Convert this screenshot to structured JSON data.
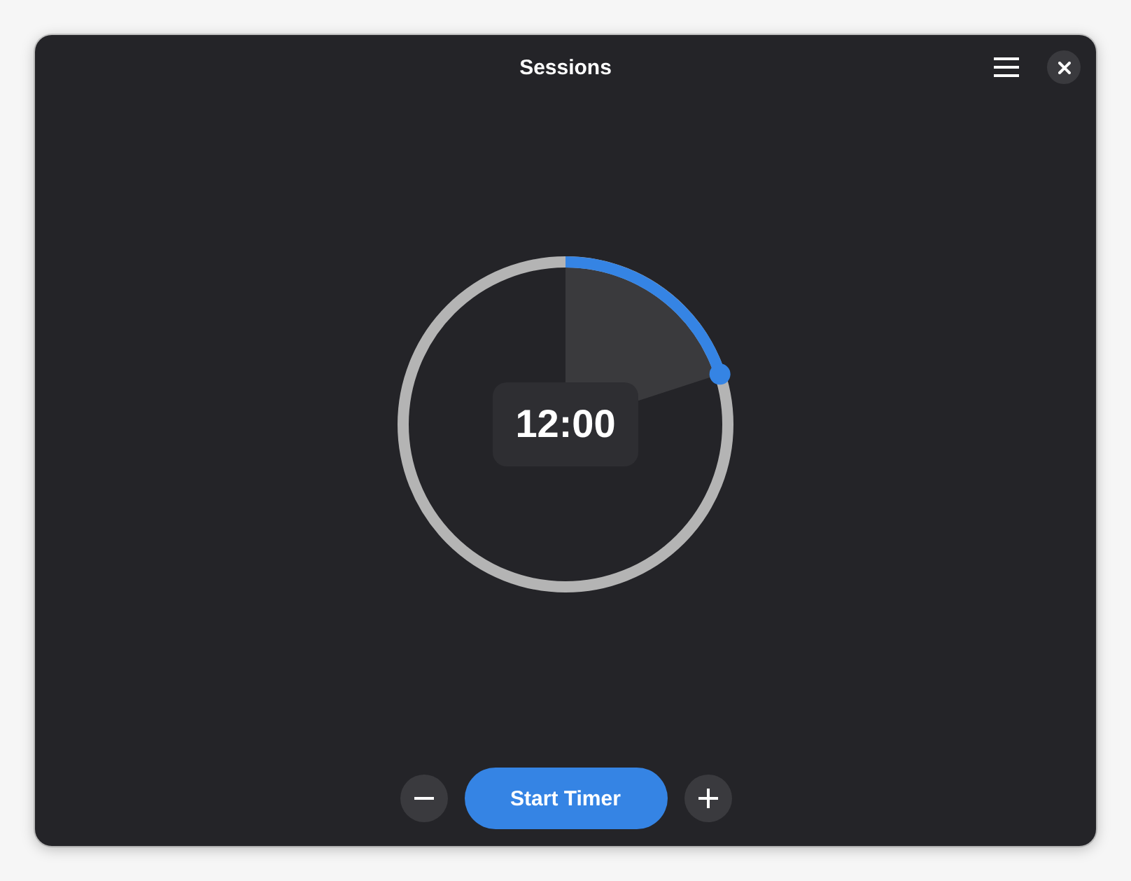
{
  "window": {
    "title": "Sessions"
  },
  "timer": {
    "time": "12:00",
    "level": 0.2
  },
  "start_button": {
    "label": "Start Timer"
  }
}
